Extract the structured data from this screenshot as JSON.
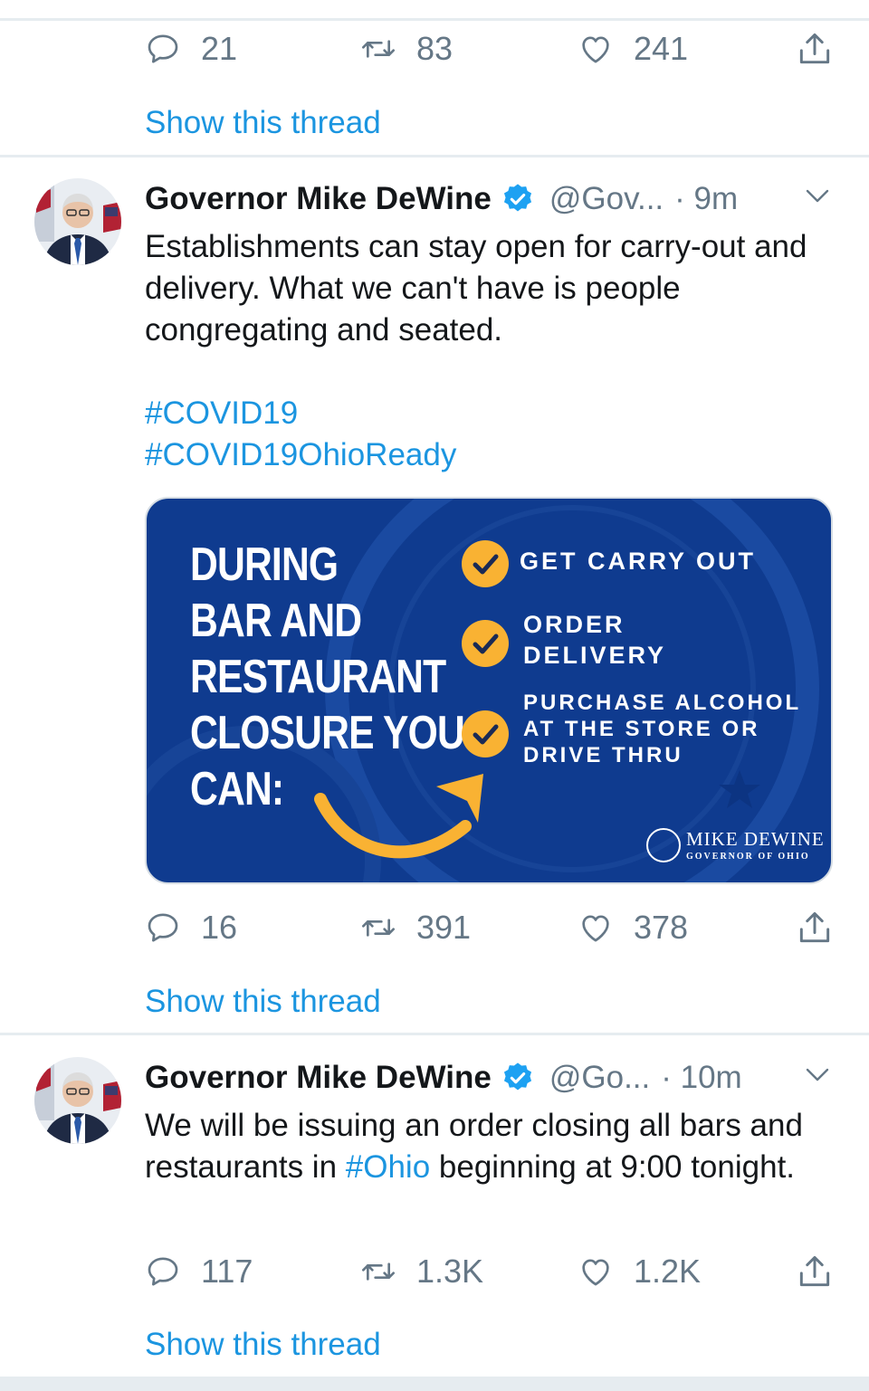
{
  "colors": {
    "accent": "#1b95e0",
    "muted": "#657786",
    "card_bg": "#0f3b8f",
    "card_yellow": "#f9b233"
  },
  "tweet0": {
    "replies": "21",
    "retweets": "83",
    "likes": "241",
    "show_thread": "Show this thread"
  },
  "tweet1": {
    "name": "Governor Mike DeWine",
    "handle": "@Gov...",
    "time": "· 9m",
    "text": "Establishments can stay open for carry-out and delivery. What we can't have is people congregating and seated.",
    "hashtags": [
      "#COVID19",
      "#COVID19OhioReady"
    ],
    "card": {
      "headline_lines": [
        "DURING",
        "BAR AND",
        "RESTAURANT",
        "CLOSURE YOU",
        "CAN:"
      ],
      "options": [
        {
          "lines": [
            "GET CARRY OUT"
          ]
        },
        {
          "lines": [
            "ORDER",
            "DELIVERY"
          ]
        },
        {
          "lines": [
            "PURCHASE ALCOHOL",
            "AT THE STORE OR",
            "DRIVE THRU"
          ]
        }
      ],
      "brand_name": "MIKE DEWINE",
      "brand_sub": "GOVERNOR OF OHIO"
    },
    "replies": "16",
    "retweets": "391",
    "likes": "378",
    "show_thread": "Show this thread"
  },
  "tweet2": {
    "name": "Governor Mike DeWine",
    "handle": "@Go...",
    "time": "· 10m",
    "text_before": "We will be issuing an order closing all bars and restaurants in ",
    "hashtag": "#Ohio",
    "text_after": " beginning at 9:00 tonight.",
    "replies": "117",
    "retweets": "1.3K",
    "likes": "1.2K",
    "show_thread": "Show this thread"
  },
  "icons": [
    "reply-icon",
    "retweet-icon",
    "like-icon",
    "share-icon",
    "verified-badge-icon",
    "chevron-down-icon",
    "checkmark-icon",
    "arrow-icon"
  ]
}
